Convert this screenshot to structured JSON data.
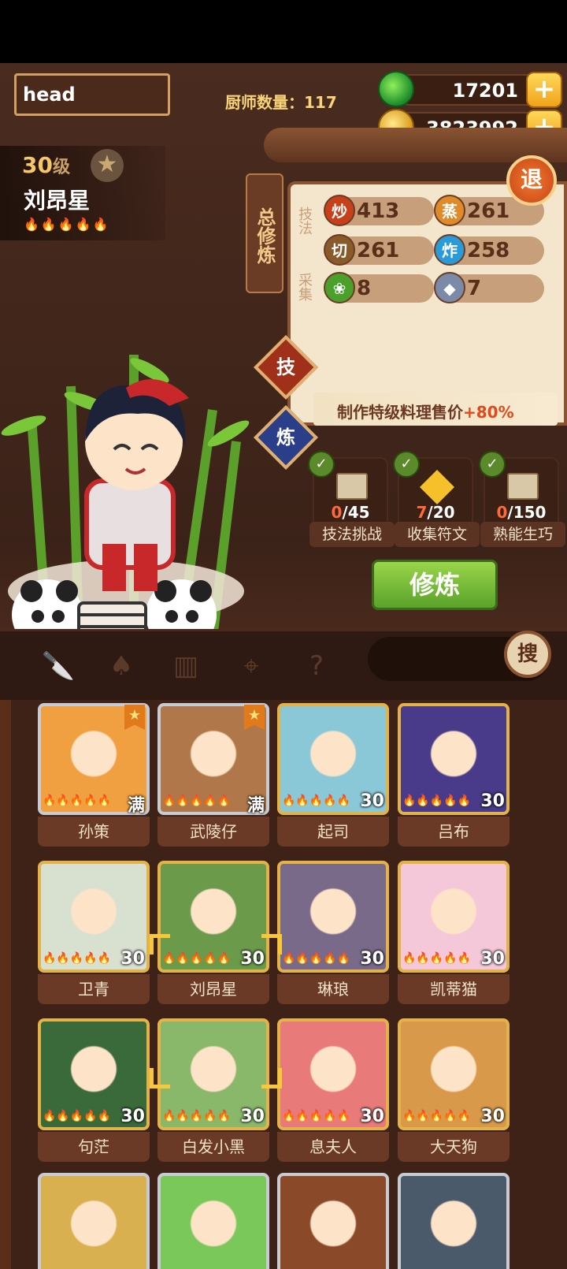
{
  "header": {
    "search_value": "head",
    "chef_count_label": "厨师数量：117",
    "jade": "17201",
    "coins": "3823992",
    "exit_label": "退"
  },
  "chef": {
    "level": "30",
    "level_unit": "级",
    "name": "刘昂星",
    "rarity_flames": 5
  },
  "panel": {
    "total_tab": "总修炼",
    "skill_label": "技法",
    "gather_label": "采集",
    "stats": [
      {
        "icon": "炒",
        "value": "413",
        "color": "#c8401a"
      },
      {
        "icon": "蒸",
        "value": "261",
        "color": "#e08a2a"
      },
      {
        "icon": "切",
        "value": "261",
        "color": "#8a5a2a"
      },
      {
        "icon": "炸",
        "value": "258",
        "color": "#2a9ad8"
      },
      {
        "icon": "veg-icon",
        "value": "8",
        "color": "#4aa02a"
      },
      {
        "icon": "fish-icon",
        "value": "7",
        "color": "#7a8aa8"
      }
    ],
    "tab_skill": "技",
    "tab_refine": "炼",
    "bonus_text": "制作特级料理售价",
    "bonus_value": "+80%",
    "tasks": [
      {
        "done": "0",
        "total": "/45",
        "label": "技法挑战"
      },
      {
        "done": "7",
        "total": "/20",
        "label": "收集符文"
      },
      {
        "done": "0",
        "total": "/150",
        "label": "熟能生巧"
      }
    ],
    "cultivate_label": "修炼"
  },
  "toolbar": {
    "icons": [
      "knife-icon",
      "spatula-icon",
      "jar-icon",
      "map-pin-icon",
      "book-question-icon"
    ],
    "search_label": "搜"
  },
  "chefs": [
    {
      "name": "孙策",
      "level": "满",
      "frame": "silver",
      "badge": true,
      "bg": "#f0a040"
    },
    {
      "name": "武陵仔",
      "level": "满",
      "frame": "silver",
      "badge": true,
      "bg": "#b0784a"
    },
    {
      "name": "起司",
      "level": "30",
      "frame": "gold",
      "badge": false,
      "bg": "#8ac8d8"
    },
    {
      "name": "吕布",
      "level": "30",
      "frame": "gold",
      "badge": false,
      "bg": "#4a3a8a"
    },
    {
      "name": "卫青",
      "level": "30",
      "frame": "gold",
      "badge": false,
      "bg": "#d8e0d0"
    },
    {
      "name": "刘昂星",
      "level": "30",
      "frame": "gold",
      "badge": false,
      "bg": "#6a9a4a"
    },
    {
      "name": "琳琅",
      "level": "30",
      "frame": "gold",
      "badge": false,
      "bg": "#7a6a8a"
    },
    {
      "name": "凯蒂猫",
      "level": "30",
      "frame": "gold",
      "badge": false,
      "bg": "#f4c8d8"
    },
    {
      "name": "句茫",
      "level": "30",
      "frame": "gold",
      "badge": false,
      "bg": "#3a6a3a"
    },
    {
      "name": "白发小黑",
      "level": "30",
      "frame": "gold",
      "badge": false,
      "bg": "#8ab86a"
    },
    {
      "name": "息夫人",
      "level": "30",
      "frame": "gold",
      "badge": false,
      "bg": "#e87a7a"
    },
    {
      "name": "大天狗",
      "level": "30",
      "frame": "gold",
      "badge": false,
      "bg": "#d89a4a"
    },
    {
      "name": "",
      "level": "",
      "frame": "silver",
      "badge": false,
      "bg": "#d8b050"
    },
    {
      "name": "",
      "level": "",
      "frame": "silver",
      "badge": false,
      "bg": "#7ac85a"
    },
    {
      "name": "",
      "level": "",
      "frame": "silver",
      "badge": false,
      "bg": "#8a4a2a"
    },
    {
      "name": "",
      "level": "",
      "frame": "silver",
      "badge": false,
      "bg": "#4a5a6a"
    }
  ]
}
